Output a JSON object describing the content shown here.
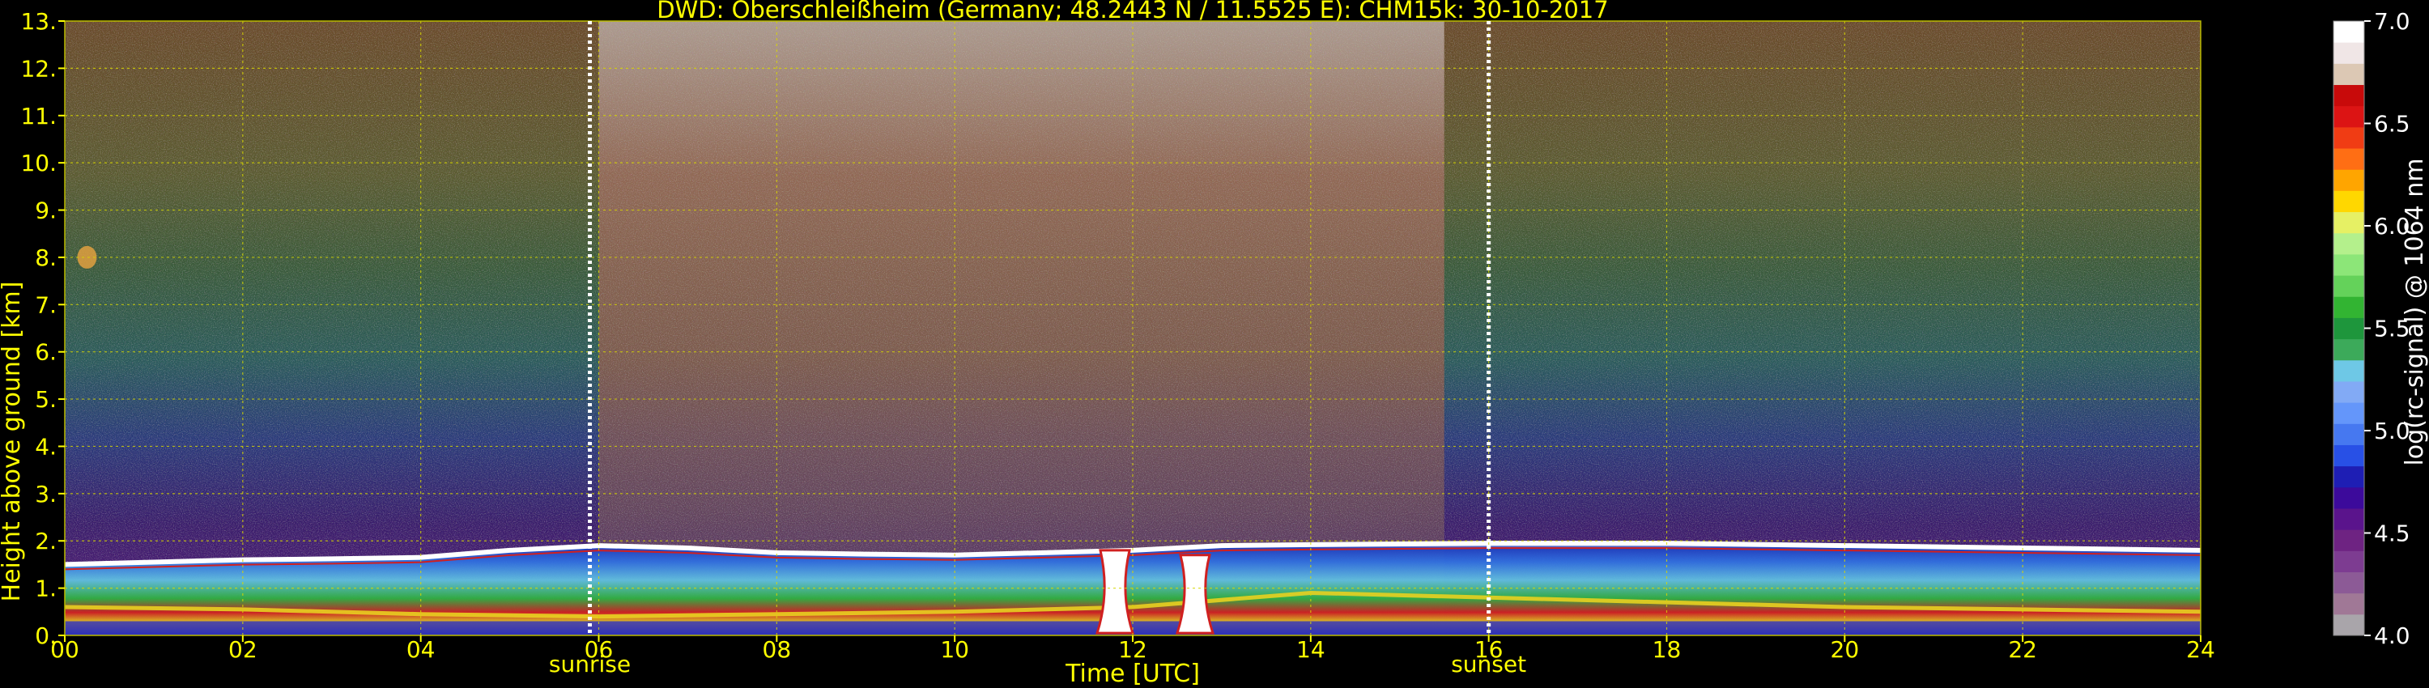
{
  "chart_data": {
    "type": "heatmap",
    "title": "DWD: Oberschleißheim (Germany; 48.2443 N / 11.5525 E):    CHM15k: 30-10-2017",
    "xlabel": "Time [UTC]",
    "ylabel": "Height above ground [km]",
    "xlim": [
      0,
      24
    ],
    "ylim": [
      0,
      13
    ],
    "x_ticks": [
      "00",
      "02",
      "04",
      "06",
      "08",
      "10",
      "12",
      "14",
      "16",
      "18",
      "20",
      "22",
      "24"
    ],
    "y_ticks": [
      "0.",
      "1.",
      "2.",
      "3.",
      "4.",
      "5.",
      "6.",
      "7.",
      "8.",
      "9.",
      "10.",
      "11.",
      "12.",
      "13."
    ],
    "grid": true,
    "markers": [
      {
        "label": "sunrise",
        "time": 5.9
      },
      {
        "label": "sunset",
        "time": 16.0
      }
    ],
    "colorbar": {
      "label": "log(rc-signal) @ 1064 nm",
      "range": [
        4.0,
        7.0
      ],
      "ticks": [
        "4.0",
        "4.5",
        "5.0",
        "5.5",
        "6.0",
        "6.5",
        "7.0"
      ],
      "colors": [
        "#a9a5aa",
        "#a07896",
        "#8c5a96",
        "#7d3c91",
        "#6e2382",
        "#5a148c",
        "#3c0a9b",
        "#1e1eb4",
        "#2850e6",
        "#4678f0",
        "#6496fa",
        "#82aaf5",
        "#6ec8e6",
        "#3caa5a",
        "#1e963c",
        "#32b432",
        "#64d25a",
        "#8ce678",
        "#b4f08c",
        "#e6f064",
        "#ffd700",
        "#ffa500",
        "#ff6e14",
        "#f03c14",
        "#dc1414",
        "#c80a0a",
        "#dcc8b4",
        "#f0e6e6",
        "#ffffff"
      ]
    },
    "layers": [
      {
        "name": "boundary layer top",
        "height_km": [
          [
            0,
            1.5
          ],
          [
            1,
            1.55
          ],
          [
            2,
            1.6
          ],
          [
            3,
            1.62
          ],
          [
            4,
            1.65
          ],
          [
            5,
            1.8
          ],
          [
            6,
            1.9
          ],
          [
            7,
            1.85
          ],
          [
            8,
            1.75
          ],
          [
            9,
            1.72
          ],
          [
            10,
            1.7
          ],
          [
            11,
            1.75
          ],
          [
            12,
            1.8
          ],
          [
            13,
            1.9
          ],
          [
            14,
            1.92
          ],
          [
            16,
            1.95
          ],
          [
            18,
            1.95
          ],
          [
            20,
            1.9
          ],
          [
            22,
            1.85
          ],
          [
            24,
            1.8
          ]
        ]
      },
      {
        "name": "surface aerosol",
        "height_km": [
          [
            0,
            0.6
          ],
          [
            2,
            0.55
          ],
          [
            4,
            0.45
          ],
          [
            6,
            0.4
          ],
          [
            8,
            0.45
          ],
          [
            10,
            0.5
          ],
          [
            12,
            0.6
          ],
          [
            14,
            0.9
          ],
          [
            16,
            0.8
          ],
          [
            18,
            0.7
          ],
          [
            20,
            0.6
          ],
          [
            22,
            0.55
          ],
          [
            24,
            0.5
          ]
        ]
      }
    ],
    "features": [
      {
        "name": "aerosol spot",
        "time": 0.25,
        "height_km": 8.0
      },
      {
        "name": "cloud plume",
        "time": 11.8,
        "height_km": 1.8
      },
      {
        "name": "cloud plume",
        "time": 12.7,
        "height_km": 1.7
      }
    ]
  }
}
